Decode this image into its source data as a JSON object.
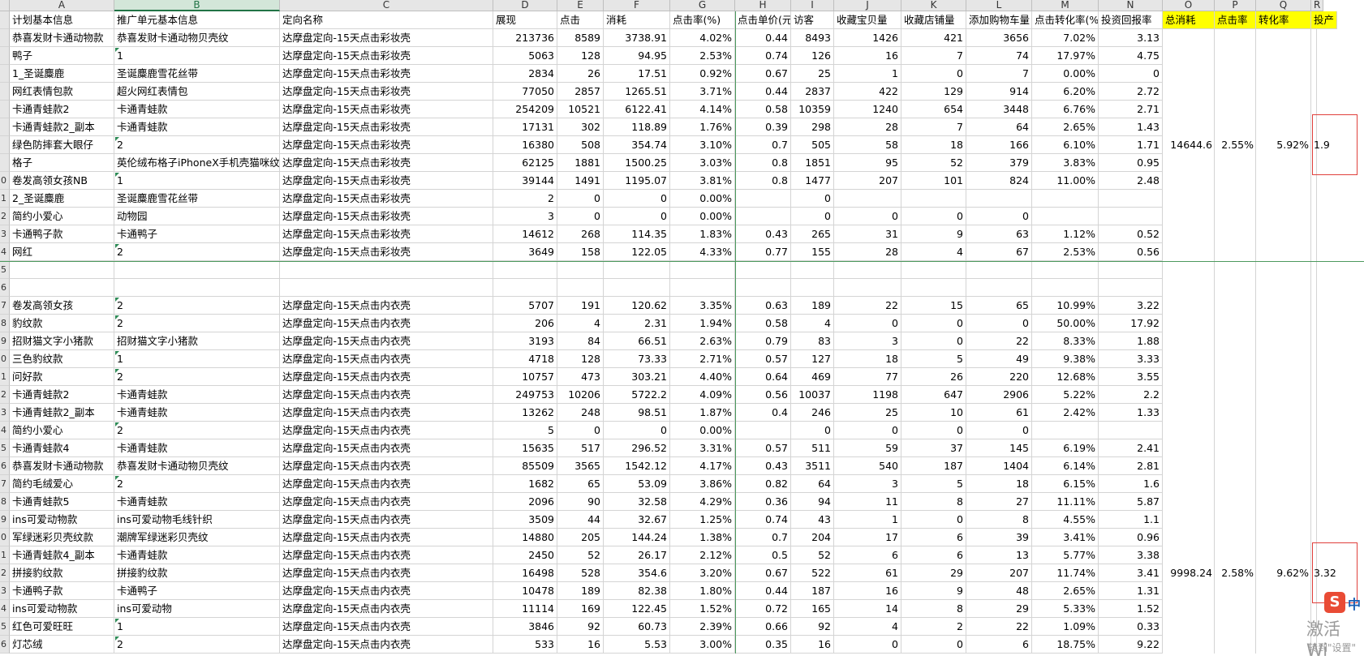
{
  "columns": [
    "A",
    "B",
    "C",
    "D",
    "E",
    "F",
    "G",
    "H",
    "I",
    "J",
    "K",
    "L",
    "M",
    "N",
    "O",
    "P",
    "Q",
    "R"
  ],
  "selected_column": "B",
  "header_row": [
    "计划基本信息",
    "推广单元基本信息",
    "定向名称",
    "展现",
    "点击",
    "消耗",
    "点击率(%)",
    "点击单价(元)",
    "访客",
    "收藏宝贝量",
    "收藏店铺量",
    "添加购物车量",
    "点击转化率(%)",
    "投资回报率",
    "总消耗",
    "点击率",
    "转化率",
    "投产"
  ],
  "rows": [
    {
      "n": "",
      "cells": [
        "恭喜发财卡通动物款",
        "恭喜发财卡通动物贝壳纹",
        "达摩盘定向-15天点击彩妆壳",
        "213736",
        "8589",
        "3738.91",
        "4.02%",
        "0.44",
        "8493",
        "1426",
        "421",
        "3656",
        "7.02%",
        "3.13"
      ]
    },
    {
      "n": "",
      "cells": [
        "鸭子",
        "1",
        "达摩盘定向-15天点击彩妆壳",
        "5063",
        "128",
        "94.95",
        "2.53%",
        "0.74",
        "126",
        "16",
        "7",
        "74",
        "17.97%",
        "4.75"
      ],
      "tri": true
    },
    {
      "n": "",
      "cells": [
        "1_圣诞麋鹿",
        "圣诞麋鹿雪花丝带",
        "达摩盘定向-15天点击彩妆壳",
        "2834",
        "26",
        "17.51",
        "0.92%",
        "0.67",
        "25",
        "1",
        "0",
        "7",
        "0.00%",
        "0"
      ]
    },
    {
      "n": "",
      "cells": [
        "网红表情包款",
        "超火网红表情包",
        "达摩盘定向-15天点击彩妆壳",
        "77050",
        "2857",
        "1265.51",
        "3.71%",
        "0.44",
        "2837",
        "422",
        "129",
        "914",
        "6.20%",
        "2.72"
      ]
    },
    {
      "n": "",
      "cells": [
        "卡通青蛙款2",
        "卡通青蛙款",
        "达摩盘定向-15天点击彩妆壳",
        "254209",
        "10521",
        "6122.41",
        "4.14%",
        "0.58",
        "10359",
        "1240",
        "654",
        "3448",
        "6.76%",
        "2.71"
      ]
    },
    {
      "n": "",
      "cells": [
        "卡通青蛙款2_副本",
        "卡通青蛙款",
        "达摩盘定向-15天点击彩妆壳",
        "17131",
        "302",
        "118.89",
        "1.76%",
        "0.39",
        "298",
        "28",
        "7",
        "64",
        "2.65%",
        "1.43"
      ]
    },
    {
      "n": "",
      "cells": [
        "绿色防摔套大眼仔",
        "2",
        "达摩盘定向-15天点击彩妆壳",
        "16380",
        "508",
        "354.74",
        "3.10%",
        "0.7",
        "505",
        "58",
        "18",
        "166",
        "6.10%",
        "1.71"
      ],
      "tri": true
    },
    {
      "n": "",
      "cells": [
        "格子",
        "英伦绒布格子iPhoneX手机壳猫咪纹",
        "达摩盘定向-15天点击彩妆壳",
        "62125",
        "1881",
        "1500.25",
        "3.03%",
        "0.8",
        "1851",
        "95",
        "52",
        "379",
        "3.83%",
        "0.95"
      ]
    },
    {
      "n": "0",
      "cells": [
        "卷发高领女孩NB",
        "1",
        "达摩盘定向-15天点击彩妆壳",
        "39144",
        "1491",
        "1195.07",
        "3.81%",
        "0.8",
        "1477",
        "207",
        "101",
        "824",
        "11.00%",
        "2.48"
      ],
      "tri": true
    },
    {
      "n": "1",
      "cells": [
        "2_圣诞麋鹿",
        "圣诞麋鹿雪花丝带",
        "达摩盘定向-15天点击彩妆壳",
        "2",
        "0",
        "0",
        "0.00%",
        "",
        "0",
        "",
        "",
        "",
        "",
        ""
      ]
    },
    {
      "n": "2",
      "cells": [
        "简约小爱心",
        "动物园",
        "达摩盘定向-15天点击彩妆壳",
        "3",
        "0",
        "0",
        "0.00%",
        "",
        "0",
        "0",
        "0",
        "0",
        "",
        ""
      ]
    },
    {
      "n": "3",
      "cells": [
        "卡通鸭子款",
        "卡通鸭子",
        "达摩盘定向-15天点击彩妆壳",
        "14612",
        "268",
        "114.35",
        "1.83%",
        "0.43",
        "265",
        "31",
        "9",
        "63",
        "1.12%",
        "0.52"
      ]
    },
    {
      "n": "4",
      "cells": [
        "网红",
        "2",
        "达摩盘定向-15天点击彩妆壳",
        "3649",
        "158",
        "122.05",
        "4.33%",
        "0.77",
        "155",
        "28",
        "4",
        "67",
        "2.53%",
        "0.56"
      ],
      "tri": true
    },
    {
      "n": "5",
      "cells": [
        "",
        "",
        "",
        "",
        "",
        "",
        "",
        "",
        "",
        "",
        "",
        "",
        "",
        ""
      ]
    },
    {
      "n": "6",
      "cells": [
        "",
        "",
        "",
        "",
        "",
        "",
        "",
        "",
        "",
        "",
        "",
        "",
        "",
        ""
      ]
    },
    {
      "n": "7",
      "cells": [
        "卷发高领女孩",
        "2",
        "达摩盘定向-15天点击内衣壳",
        "5707",
        "191",
        "120.62",
        "3.35%",
        "0.63",
        "189",
        "22",
        "15",
        "65",
        "10.99%",
        "3.22"
      ],
      "tri": true
    },
    {
      "n": "8",
      "cells": [
        "豹纹款",
        "2",
        "达摩盘定向-15天点击内衣壳",
        "206",
        "4",
        "2.31",
        "1.94%",
        "0.58",
        "4",
        "0",
        "0",
        "0",
        "50.00%",
        "17.92"
      ],
      "tri": true
    },
    {
      "n": "9",
      "cells": [
        "招财猫文字小猪款",
        "招财猫文字小猪款",
        "达摩盘定向-15天点击内衣壳",
        "3193",
        "84",
        "66.51",
        "2.63%",
        "0.79",
        "83",
        "3",
        "0",
        "22",
        "8.33%",
        "1.88"
      ]
    },
    {
      "n": "0",
      "cells": [
        "三色豹纹款",
        "1",
        "达摩盘定向-15天点击内衣壳",
        "4718",
        "128",
        "73.33",
        "2.71%",
        "0.57",
        "127",
        "18",
        "5",
        "49",
        "9.38%",
        "3.33"
      ],
      "tri": true
    },
    {
      "n": "1",
      "cells": [
        "问好款",
        "2",
        "达摩盘定向-15天点击内衣壳",
        "10757",
        "473",
        "303.21",
        "4.40%",
        "0.64",
        "469",
        "77",
        "26",
        "220",
        "12.68%",
        "3.55"
      ],
      "tri": true
    },
    {
      "n": "2",
      "cells": [
        "卡通青蛙款2",
        "卡通青蛙款",
        "达摩盘定向-15天点击内衣壳",
        "249753",
        "10206",
        "5722.2",
        "4.09%",
        "0.56",
        "10037",
        "1198",
        "647",
        "2906",
        "5.22%",
        "2.2"
      ]
    },
    {
      "n": "3",
      "cells": [
        "卡通青蛙款2_副本",
        "卡通青蛙款",
        "达摩盘定向-15天点击内衣壳",
        "13262",
        "248",
        "98.51",
        "1.87%",
        "0.4",
        "246",
        "25",
        "10",
        "61",
        "2.42%",
        "1.33"
      ]
    },
    {
      "n": "4",
      "cells": [
        "简约小爱心",
        "2",
        "达摩盘定向-15天点击内衣壳",
        "5",
        "0",
        "0",
        "0.00%",
        "",
        "0",
        "0",
        "0",
        "0",
        "",
        ""
      ],
      "tri": true
    },
    {
      "n": "5",
      "cells": [
        "卡通青蛙款4",
        "卡通青蛙款",
        "达摩盘定向-15天点击内衣壳",
        "15635",
        "517",
        "296.52",
        "3.31%",
        "0.57",
        "511",
        "59",
        "37",
        "145",
        "6.19%",
        "2.41"
      ]
    },
    {
      "n": "6",
      "cells": [
        "恭喜发财卡通动物款",
        "恭喜发财卡通动物贝壳纹",
        "达摩盘定向-15天点击内衣壳",
        "85509",
        "3565",
        "1542.12",
        "4.17%",
        "0.43",
        "3511",
        "540",
        "187",
        "1404",
        "6.14%",
        "2.81"
      ]
    },
    {
      "n": "7",
      "cells": [
        "简约毛绒爱心",
        "2",
        "达摩盘定向-15天点击内衣壳",
        "1682",
        "65",
        "53.09",
        "3.86%",
        "0.82",
        "64",
        "3",
        "5",
        "18",
        "6.15%",
        "1.6"
      ],
      "tri": true
    },
    {
      "n": "8",
      "cells": [
        "卡通青蛙款5",
        "卡通青蛙款",
        "达摩盘定向-15天点击内衣壳",
        "2096",
        "90",
        "32.58",
        "4.29%",
        "0.36",
        "94",
        "11",
        "8",
        "27",
        "11.11%",
        "5.87"
      ]
    },
    {
      "n": "9",
      "cells": [
        "ins可爱动物款",
        "ins可爱动物毛线针织",
        "达摩盘定向-15天点击内衣壳",
        "3509",
        "44",
        "32.67",
        "1.25%",
        "0.74",
        "43",
        "1",
        "0",
        "8",
        "4.55%",
        "1.1"
      ]
    },
    {
      "n": "0",
      "cells": [
        "军绿迷彩贝壳纹款",
        "潮牌军绿迷彩贝壳纹",
        "达摩盘定向-15天点击内衣壳",
        "14880",
        "205",
        "144.24",
        "1.38%",
        "0.7",
        "204",
        "17",
        "6",
        "39",
        "3.41%",
        "0.96"
      ]
    },
    {
      "n": "1",
      "cells": [
        "卡通青蛙款4_副本",
        "卡通青蛙款",
        "达摩盘定向-15天点击内衣壳",
        "2450",
        "52",
        "26.17",
        "2.12%",
        "0.5",
        "52",
        "6",
        "6",
        "13",
        "5.77%",
        "3.38"
      ]
    },
    {
      "n": "2",
      "cells": [
        "拼接豹纹款",
        "拼接豹纹款",
        "达摩盘定向-15天点击内衣壳",
        "16498",
        "528",
        "354.6",
        "3.20%",
        "0.67",
        "522",
        "61",
        "29",
        "207",
        "11.74%",
        "3.41"
      ]
    },
    {
      "n": "3",
      "cells": [
        "卡通鸭子款",
        "卡通鸭子",
        "达摩盘定向-15天点击内衣壳",
        "10478",
        "189",
        "82.38",
        "1.80%",
        "0.44",
        "187",
        "16",
        "9",
        "48",
        "2.65%",
        "1.31"
      ]
    },
    {
      "n": "4",
      "cells": [
        "ins可爱动物款",
        "ins可爱动物",
        "达摩盘定向-15天点击内衣壳",
        "11114",
        "169",
        "122.45",
        "1.52%",
        "0.72",
        "165",
        "14",
        "8",
        "29",
        "5.33%",
        "1.52"
      ]
    },
    {
      "n": "5",
      "cells": [
        "红色可爱旺旺",
        "1",
        "达摩盘定向-15天点击内衣壳",
        "3846",
        "92",
        "60.73",
        "2.39%",
        "0.66",
        "92",
        "4",
        "2",
        "22",
        "1.09%",
        "0.33"
      ],
      "tri": true
    },
    {
      "n": "6",
      "cells": [
        "灯芯绒",
        "2",
        "达摩盘定向-15天点击内衣壳",
        "533",
        "16",
        "5.53",
        "3.00%",
        "0.35",
        "16",
        "0",
        "0",
        "6",
        "18.75%",
        "9.22"
      ],
      "tri": true
    }
  ],
  "summary1": {
    "total_cost": "14644.6",
    "ctr": "2.55%",
    "cvr": "5.92%",
    "roi": "1.9"
  },
  "summary2": {
    "total_cost": "9998.24",
    "ctr": "2.58%",
    "cvr": "9.62%",
    "roi": "3.32"
  },
  "overlay": {
    "wps_badge": "S",
    "wps_lang": "中",
    "activate_title": "激活 Wi",
    "activate_sub": "转到\"设置\""
  },
  "colors": {
    "yellow_header": "#ffff00",
    "red_box": "#e0403c",
    "selection_green": "#217346"
  }
}
